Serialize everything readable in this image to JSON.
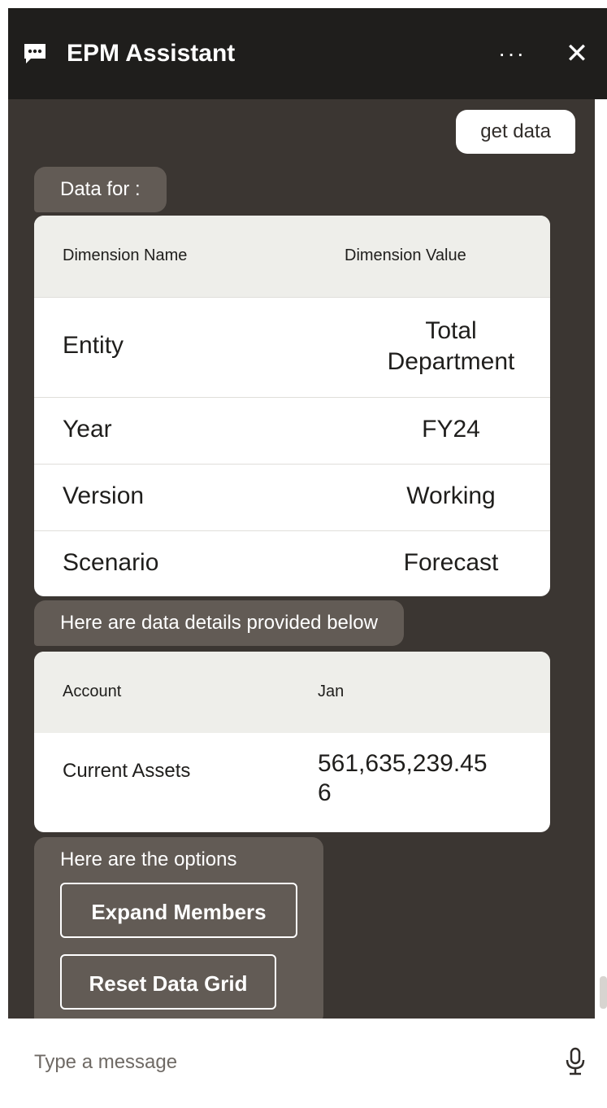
{
  "header": {
    "title": "EPM Assistant",
    "more_label": "···",
    "close_label": "✕"
  },
  "messages": {
    "user_query": "get data",
    "data_for_label": "Data for :",
    "dimension_table": {
      "headers": [
        "Dimension Name",
        "Dimension Value"
      ],
      "rows": [
        {
          "name": "Entity",
          "value_line1": "Total",
          "value_line2": "Department"
        },
        {
          "name": "Year",
          "value_line1": "FY24"
        },
        {
          "name": "Version",
          "value_line1": "Working"
        },
        {
          "name": "Scenario",
          "value_line1": "Forecast"
        }
      ]
    },
    "details_label": "Here are data details provided below",
    "data_table": {
      "headers": [
        "Account",
        "Jan"
      ],
      "rows": [
        {
          "account": "Current Assets",
          "value_line1": "561,635,239.45",
          "value_line2": "6"
        }
      ]
    },
    "options_label": "Here are the options",
    "options": [
      "Expand Members",
      "Reset Data Grid"
    ]
  },
  "composer": {
    "placeholder": "Type a message"
  },
  "colors": {
    "header_bg": "#1f1e1c",
    "conversation_bg": "#3b3632",
    "bot_bubble": "#625b55",
    "table_header": "#eeeeea"
  },
  "icons": {
    "chat": "chat-bubble-icon",
    "mic": "microphone-icon"
  }
}
